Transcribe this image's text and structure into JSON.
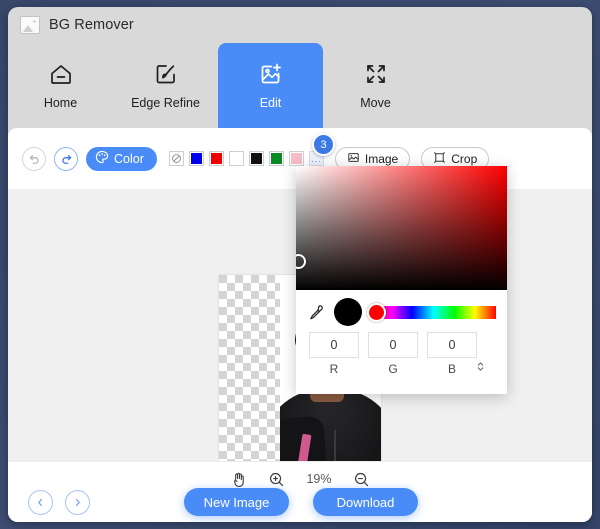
{
  "window": {
    "title": "BG Remover",
    "logo_icon": "image-placeholder-icon"
  },
  "tabs": [
    {
      "label": "Home",
      "icon": "home-icon",
      "active": false
    },
    {
      "label": "Edge Refine",
      "icon": "brush-square-icon",
      "active": false
    },
    {
      "label": "Edit",
      "icon": "image-edit-icon",
      "active": true
    },
    {
      "label": "Move",
      "icon": "move-arrows-icon",
      "active": false
    }
  ],
  "toolbar": {
    "undo_icon": "undo-arrow-icon",
    "redo_icon": "redo-arrow-icon",
    "color_label": "Color",
    "color_icon": "palette-icon",
    "swatches": [
      {
        "name": "none",
        "color": "none"
      },
      {
        "name": "blue",
        "color": "#0000ee"
      },
      {
        "name": "red",
        "color": "#ee0000"
      },
      {
        "name": "white",
        "color": "#ffffff"
      },
      {
        "name": "black",
        "color": "#111111"
      },
      {
        "name": "green",
        "color": "#0a8a22"
      },
      {
        "name": "pink",
        "color": "#f7bcc8"
      }
    ],
    "more_label": "...",
    "image_label": "Image",
    "image_icon": "picture-icon",
    "crop_label": "Crop",
    "crop_icon": "crop-frame-icon",
    "badge": "3"
  },
  "picker": {
    "dropper_icon": "eyedropper-icon",
    "preview_color": "#000000",
    "hue_color": "#ff0000",
    "channels": [
      {
        "label": "R",
        "value": "0"
      },
      {
        "label": "G",
        "value": "0"
      },
      {
        "label": "B",
        "value": "0"
      }
    ],
    "stepper_icon": "stepper-up-down-icon"
  },
  "zoombar": {
    "hand_icon": "hand-pan-icon",
    "zoom_in_icon": "zoom-in-icon",
    "zoom_level": "19%",
    "zoom_out_icon": "zoom-out-icon"
  },
  "footer": {
    "prev_icon": "chevron-left-icon",
    "next_icon": "chevron-right-icon",
    "new_image_label": "New Image",
    "download_label": "Download"
  },
  "theme": {
    "accent": "#4a8cf7",
    "window_bg": "#d9d9d9",
    "canvas_bg": "#f0f0f0",
    "desktop_bg": "#3b4a6b"
  }
}
